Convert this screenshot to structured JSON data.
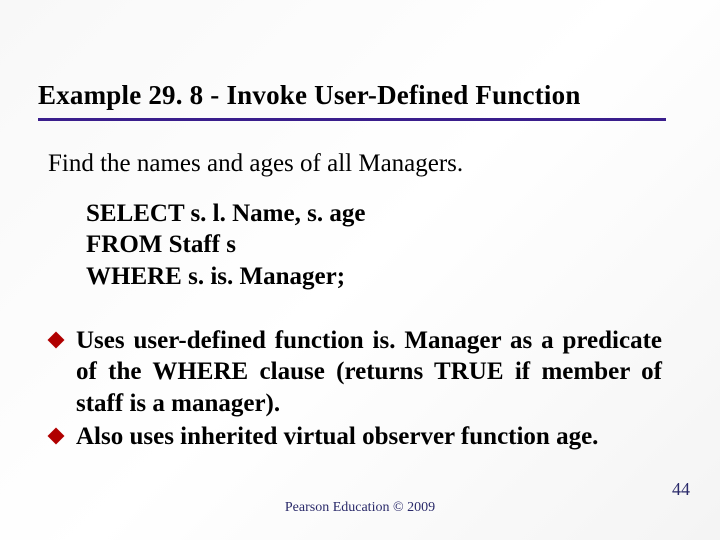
{
  "title": "Example 29. 8 - Invoke User-Defined Function",
  "prompt": "Find the names and ages of all Managers.",
  "sql": {
    "line1": "SELECT s. l. Name, s. age",
    "line2": "FROM Staff s",
    "line3": "WHERE s. is. Manager;"
  },
  "bullets": [
    "Uses user-defined function is. Manager as a predicate of the WHERE clause (returns TRUE if member of staff is a manager).",
    "Also uses inherited virtual observer function age."
  ],
  "footer": "Pearson Education © 2009",
  "page_number": "44"
}
